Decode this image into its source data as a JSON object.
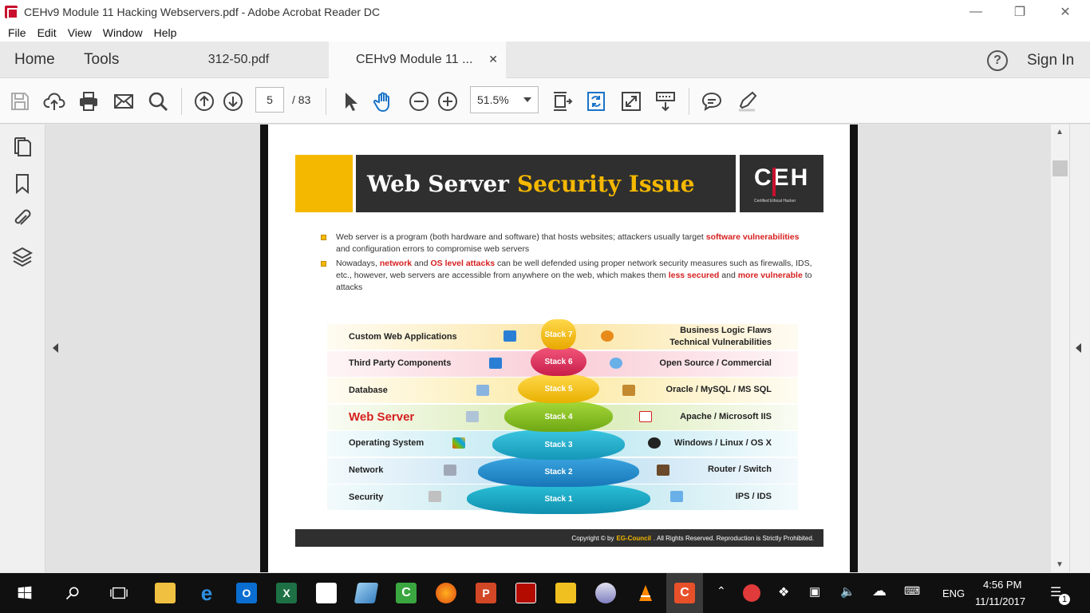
{
  "window": {
    "title": "CEHv9 Module 11 Hacking Webservers.pdf - Adobe Acrobat Reader DC",
    "controls": [
      "minimize",
      "restore",
      "close"
    ]
  },
  "menu": [
    "File",
    "Edit",
    "View",
    "Window",
    "Help"
  ],
  "tabs": {
    "home": "Home",
    "tools": "Tools",
    "doc_tabs": [
      {
        "label": "312-50.pdf",
        "active": false
      },
      {
        "label": "CEHv9 Module 11 ...",
        "active": true
      }
    ],
    "close_glyph": "✕",
    "help_glyph": "?",
    "sign_in": "Sign In"
  },
  "toolbar": {
    "page_current": "5",
    "page_total": "/ 83",
    "zoom": "51.5%",
    "icons": [
      "save-icon",
      "upload-icon",
      "print-icon",
      "email-icon",
      "search-icon",
      "page-up-icon",
      "page-down-icon",
      "select-cursor-icon",
      "hand-tool-icon",
      "zoom-out-icon",
      "zoom-in-icon",
      "fit-page-icon",
      "rotate-icon",
      "full-screen-icon",
      "scroll-mode-icon",
      "comment-icon",
      "highlight-icon"
    ]
  },
  "leftnav": [
    "pages-icon",
    "bookmark-icon",
    "attachment-icon",
    "layers-icon"
  ],
  "slide": {
    "title_white": "Web Server",
    "title_yellow": "Security Issue",
    "logo": "CEH",
    "logo_sub": "Certified  Ethical  Hacker",
    "bullet1": {
      "t1": "Web server is a program (both hardware and software) that hosts websites; attackers usually target ",
      "r1": "software vulnerabilities",
      "t2": " and configuration errors to compromise web servers"
    },
    "bullet2": {
      "t1": "Nowadays, ",
      "r1": "network",
      "t2": " and ",
      "r2": "OS level attacks",
      "t3": " can be well defended using proper network security measures such as firewalls, IDS, etc., however, web servers are accessible from anywhere on the web, which makes them ",
      "r3": "less secured",
      "t4": " and ",
      "r4": "more vulnerable",
      "t5": " to attacks"
    },
    "stack": [
      {
        "tier": "Stack 7",
        "left": "Custom Web Applications",
        "right1": "Business Logic Flaws",
        "right2": "Technical Vulnerabilities",
        "color": "#f5b800"
      },
      {
        "tier": "Stack 6",
        "left": "Third Party Components",
        "right1": "Open Source / Commercial",
        "right2": "",
        "color": "#e8365c"
      },
      {
        "tier": "Stack 5",
        "left": "Database",
        "right1": "Oracle / MySQL / MS SQL",
        "right2": "",
        "color": "#f5c400"
      },
      {
        "tier": "Stack 4",
        "left": "Web Server",
        "right1": "Apache / Microsoft IIS",
        "right2": "",
        "color": "#8cc21f"
      },
      {
        "tier": "Stack 3",
        "left": "Operating System",
        "right1": "Windows / Linux / OS X",
        "right2": "",
        "color": "#1ab0cf"
      },
      {
        "tier": "Stack 2",
        "left": "Network",
        "right1": "Router / Switch",
        "right2": "",
        "color": "#1a8fd0"
      },
      {
        "tier": "Stack 1",
        "left": "Security",
        "right1": "IPS / IDS",
        "right2": "",
        "color": "#14a6c4"
      }
    ],
    "footer": {
      "prefix": "Copyright © by",
      "brand": "EG-Council",
      "suffix": ". All Rights Reserved. Reproduction is Strictly Prohibited."
    }
  },
  "taskbar": {
    "apps": [
      "start-icon",
      "search-icon",
      "task-view-icon",
      "file-explorer-icon",
      "edge-icon",
      "outlook-icon",
      "excel-icon",
      "store-icon",
      "notepad-icon",
      "camtasia-icon",
      "firefox-icon",
      "powerpoint-icon",
      "acrobat-icon",
      "puzzle-icon",
      "network-diagram-icon",
      "vlc-icon",
      "camtasia-recorder-icon"
    ],
    "language": "ENG",
    "time": "4:56 PM",
    "date": "11/11/2017",
    "notifications": "1"
  }
}
